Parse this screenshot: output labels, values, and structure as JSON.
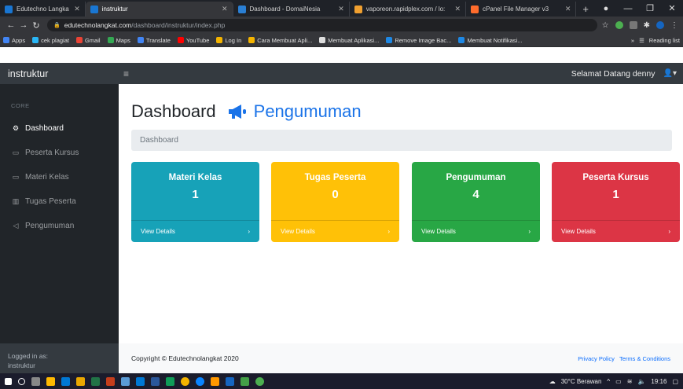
{
  "browser": {
    "tabs": [
      {
        "title": "Edutechno Langkat",
        "favicon_color": "#1976d2",
        "active": false
      },
      {
        "title": "instruktur",
        "favicon_color": "#1976d2",
        "active": true
      },
      {
        "title": "Dashboard - DomaiNesia",
        "favicon_color": "#2a7fd4",
        "active": false
      },
      {
        "title": "vaporeon.rapidplex.com / lo:",
        "favicon_color": "#f0a030",
        "active": false
      },
      {
        "title": "cPanel File Manager v3",
        "favicon_color": "#ff6c2c",
        "active": false
      }
    ],
    "url_host": "edutechnolangkat.com",
    "url_path": "/dashboard/instruktur/index.php",
    "bookmarks": [
      {
        "label": "Apps",
        "color": "#4285f4"
      },
      {
        "label": "cek plagiat",
        "color": "#29b6f6"
      },
      {
        "label": "Gmail",
        "color": "#ea4335"
      },
      {
        "label": "Maps",
        "color": "#34a853"
      },
      {
        "label": "Translate",
        "color": "#4285f4"
      },
      {
        "label": "YouTube",
        "color": "#ff0000"
      },
      {
        "label": "Log In",
        "color": "#f4b400"
      },
      {
        "label": "Cara Membuat Apli...",
        "color": "#f4b400"
      },
      {
        "label": "Membuat Aplikasi...",
        "color": "#dddddd"
      },
      {
        "label": "Remove Image Bac...",
        "color": "#1e88e5"
      },
      {
        "label": "Membuat Notifikasi...",
        "color": "#1e88e5"
      }
    ],
    "reading_list": "Reading list"
  },
  "app": {
    "brand": "instruktur",
    "welcome": "Selamat Datang denny",
    "sidebar": {
      "heading": "CORE",
      "items": [
        {
          "label": "Dashboard",
          "icon": "tachometer-icon",
          "glyph": "⚙",
          "active": true
        },
        {
          "label": "Peserta Kursus",
          "icon": "chat-icon",
          "glyph": "▭",
          "active": false
        },
        {
          "label": "Materi Kelas",
          "icon": "chat-icon",
          "glyph": "▭",
          "active": false
        },
        {
          "label": "Tugas Peserta",
          "icon": "book-icon",
          "glyph": "▥",
          "active": false
        },
        {
          "label": "Pengumuman",
          "icon": "bullhorn-icon",
          "glyph": "◁",
          "active": false
        }
      ],
      "footer_label": "Logged in as:",
      "footer_user": "instruktur"
    },
    "page_title": "Dashboard",
    "page_subtitle": "Pengumuman",
    "breadcrumb": "Dashboard",
    "cards": [
      {
        "title": "Materi Kelas",
        "value": "1",
        "link": "View Details",
        "color": "#17a2b8",
        "text_color": "#ffffff"
      },
      {
        "title": "Tugas Peserta",
        "value": "0",
        "link": "View Details",
        "color": "#ffc107",
        "text_color": "#ffffff"
      },
      {
        "title": "Pengumuman",
        "value": "4",
        "link": "View Details",
        "color": "#28a745",
        "text_color": "#ffffff"
      },
      {
        "title": "Peserta Kursus",
        "value": "1",
        "link": "View Details",
        "color": "#dc3545",
        "text_color": "#ffffff"
      }
    ],
    "copyright": "Copyright © Edutechnolangkat 2020",
    "footer_links": [
      "Privacy Policy",
      "Terms & Conditions"
    ]
  },
  "taskbar": {
    "weather": "30°C Berawan",
    "time": "19:16"
  }
}
